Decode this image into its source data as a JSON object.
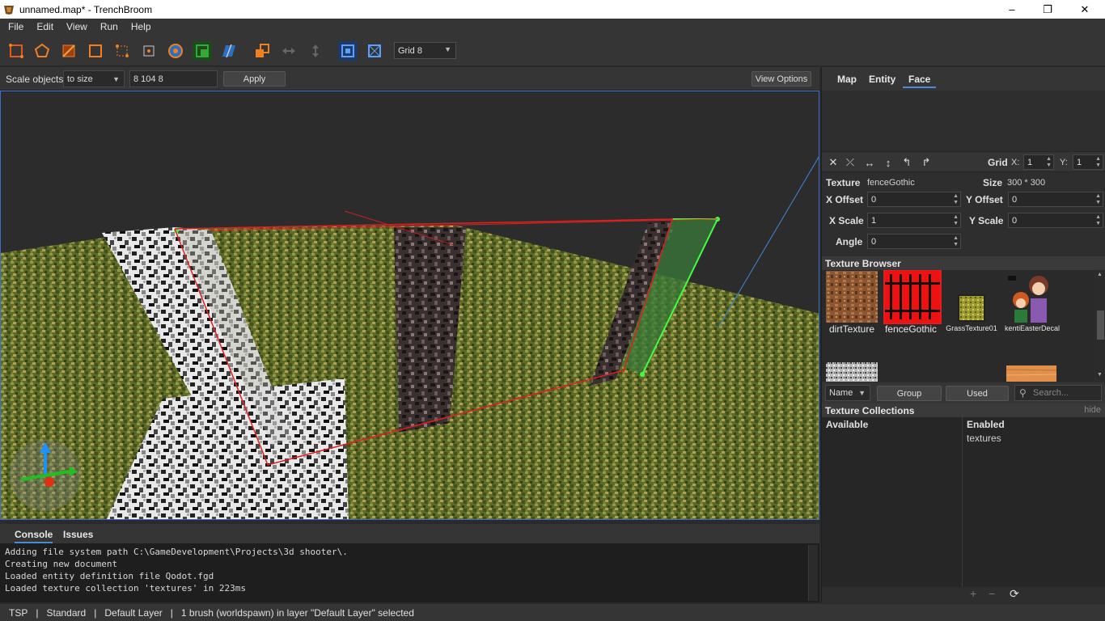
{
  "window": {
    "title": "unnamed.map* - TrenchBroom",
    "minimize": "–",
    "maximize": "❐",
    "close": "✕"
  },
  "menu": [
    "File",
    "Edit",
    "View",
    "Run",
    "Help"
  ],
  "toolbar": {
    "tools": [
      "move-tool",
      "rotate-tool",
      "scale-tool",
      "shear-tool",
      "vertex-tool",
      "edge-tool",
      "face-tool",
      "brush-tool",
      "clip-tool",
      "texture-lock",
      "uv-lock",
      "duplicate",
      "flip-horizontal",
      "flip-vertical",
      "snap-toggle",
      "select-tall"
    ],
    "grid": "Grid 8"
  },
  "scale_bar": {
    "label": "Scale objects",
    "mode": "to size",
    "value": "8 104 8",
    "apply": "Apply",
    "view_options": "View Options"
  },
  "console": {
    "tabs": [
      "Console",
      "Issues"
    ],
    "lines": [
      "Adding file system path C:\\GameDevelopment\\Projects\\3d shooter\\.",
      "Creating new document",
      "Loaded entity definition file Qodot.fgd",
      "Loaded texture collection 'textures' in 223ms"
    ]
  },
  "status": {
    "game": "TSP",
    "sep": "|",
    "mode": "Standard",
    "layer": "Default Layer",
    "selection": "1 brush (worldspawn) in layer \"Default Layer\" selected"
  },
  "inspector": {
    "tabs": [
      "Map",
      "Entity",
      "Face"
    ],
    "grid_label": "Grid",
    "grid_x_label": "X:",
    "grid_x": "1",
    "grid_y_label": "Y:",
    "grid_y": "1",
    "texture_label": "Texture",
    "texture_name": "fenceGothic",
    "size_label": "Size",
    "size_value": "300 * 300",
    "x_offset_label": "X Offset",
    "x_offset": "0",
    "y_offset_label": "Y Offset",
    "y_offset": "0",
    "x_scale_label": "X Scale",
    "x_scale": "1",
    "y_scale_label": "Y Scale",
    "y_scale": "0",
    "angle_label": "Angle",
    "angle": "0",
    "face_buttons": [
      "✕",
      "⤫",
      "↔",
      "↕",
      "↰",
      "↱"
    ]
  },
  "texture_browser": {
    "title": "Texture Browser",
    "textures": [
      {
        "name": "dirtTexture"
      },
      {
        "name": "fenceGothic"
      },
      {
        "name": "GrassTexture01"
      },
      {
        "name": "kentiEasterDecal"
      }
    ],
    "sort": "Name",
    "group": "Group",
    "used": "Used",
    "search_placeholder": "Search..."
  },
  "texture_collections": {
    "title": "Texture Collections",
    "hide": "hide",
    "available_label": "Available",
    "enabled_label": "Enabled",
    "enabled": [
      "textures"
    ],
    "footer": [
      "+",
      "−",
      "⟳"
    ]
  },
  "colors": {
    "accent": "#4a8ad8",
    "selection_red": "#e02020",
    "selection_green": "#40e040"
  }
}
